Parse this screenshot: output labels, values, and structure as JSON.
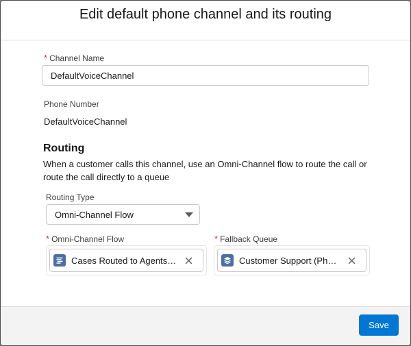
{
  "modal": {
    "title": "Edit default phone channel and its routing"
  },
  "form": {
    "required_marker": "*",
    "channel_name": {
      "label": "Channel Name",
      "value": "DefaultVoiceChannel"
    },
    "phone_number": {
      "label": "Phone Number",
      "value": "DefaultVoiceChannel"
    },
    "routing": {
      "heading": "Routing",
      "description": "When a customer calls this channel, use an Omni-Channel flow to route the call or route the call directly to a queue",
      "routing_type": {
        "label": "Routing Type",
        "selected": "Omni-Channel Flow"
      },
      "omni_channel_flow": {
        "label": "Omni-Channel Flow",
        "value": "Cases Routed to Agents and Queues",
        "icon": "flow-icon"
      },
      "fallback_queue": {
        "label": "Fallback Queue",
        "value": "Customer Support (Phone)",
        "icon": "queue-icon"
      }
    }
  },
  "footer": {
    "save_label": "Save"
  },
  "colors": {
    "brand": "#0176d3",
    "required": "#c23934",
    "icon_bg": "#4b6fa5"
  }
}
